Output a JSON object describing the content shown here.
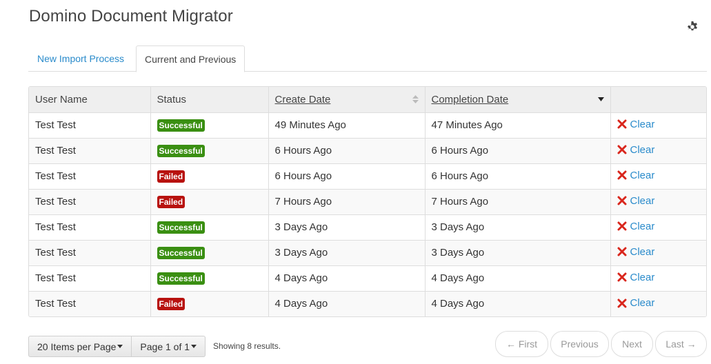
{
  "app": {
    "title": "Domino Document Migrator",
    "settings_icon": "gear-icon"
  },
  "tabs": [
    {
      "label": "New Import Process",
      "active": false
    },
    {
      "label": "Current and Previous",
      "active": true
    }
  ],
  "table": {
    "headers": {
      "user": "User Name",
      "status": "Status",
      "create": "Create Date",
      "complete": "Completion Date"
    },
    "sort": {
      "column": "Completion Date",
      "direction": "descending"
    },
    "rows": [
      {
        "user": "Test Test",
        "status": "Successful",
        "create": "49 Minutes Ago",
        "complete": "47 Minutes Ago",
        "action": "Clear"
      },
      {
        "user": "Test Test",
        "status": "Successful",
        "create": "6 Hours Ago",
        "complete": "6 Hours Ago",
        "action": "Clear"
      },
      {
        "user": "Test Test",
        "status": "Failed",
        "create": "6 Hours Ago",
        "complete": "6 Hours Ago",
        "action": "Clear"
      },
      {
        "user": "Test Test",
        "status": "Failed",
        "create": "7 Hours Ago",
        "complete": "7 Hours Ago",
        "action": "Clear"
      },
      {
        "user": "Test Test",
        "status": "Successful",
        "create": "3 Days Ago",
        "complete": "3 Days Ago",
        "action": "Clear"
      },
      {
        "user": "Test Test",
        "status": "Successful",
        "create": "3 Days Ago",
        "complete": "3 Days Ago",
        "action": "Clear"
      },
      {
        "user": "Test Test",
        "status": "Successful",
        "create": "4 Days Ago",
        "complete": "4 Days Ago",
        "action": "Clear"
      },
      {
        "user": "Test Test",
        "status": "Failed",
        "create": "4 Days Ago",
        "complete": "4 Days Ago",
        "action": "Clear"
      }
    ]
  },
  "pagination": {
    "page_size_label": "20 Items per Page",
    "page_label": "Page 1 of 1",
    "showing": "Showing 8 results.",
    "first": "← First",
    "previous": "Previous",
    "next": "Next",
    "last": "Last →"
  },
  "colors": {
    "link": "#2a8bcb",
    "success": "#3a8f12",
    "failed": "#b8120f",
    "clear_icon": "#d9261c"
  }
}
